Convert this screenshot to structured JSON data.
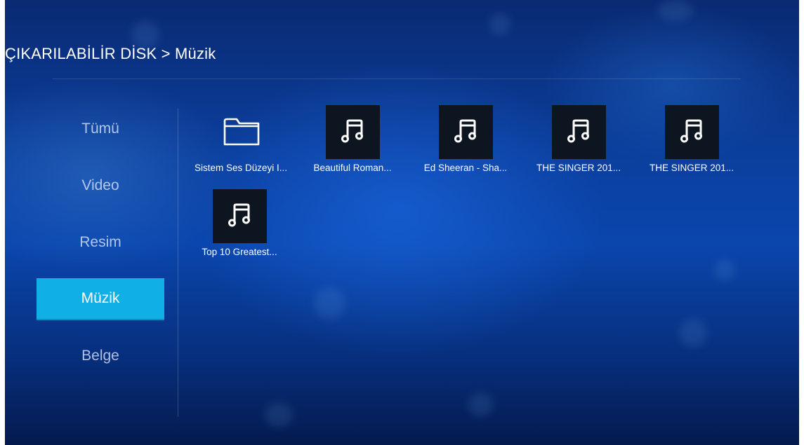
{
  "header": {
    "breadcrumb": "ÇIKARILABİLİR DİSK > Müzik"
  },
  "sidebar": {
    "items": [
      {
        "label": "Tümü",
        "active": false
      },
      {
        "label": "Video",
        "active": false
      },
      {
        "label": "Resim",
        "active": false
      },
      {
        "label": "Müzik",
        "active": true
      },
      {
        "label": "Belge",
        "active": false
      }
    ],
    "accent_color": "#10b0e6"
  },
  "files": [
    {
      "type": "folder",
      "icon": "folder-icon",
      "label": "Sistem Ses Düzeyi I..."
    },
    {
      "type": "audio",
      "icon": "music-note-icon",
      "label": "Beautiful Roman..."
    },
    {
      "type": "audio",
      "icon": "music-note-icon",
      "label": "Ed Sheeran - Sha..."
    },
    {
      "type": "audio",
      "icon": "music-note-icon",
      "label": "THE SINGER 201..."
    },
    {
      "type": "audio",
      "icon": "music-note-icon",
      "label": "THE SINGER 201..."
    },
    {
      "type": "audio",
      "icon": "music-note-icon",
      "label": "Top 10 Greatest..."
    }
  ]
}
